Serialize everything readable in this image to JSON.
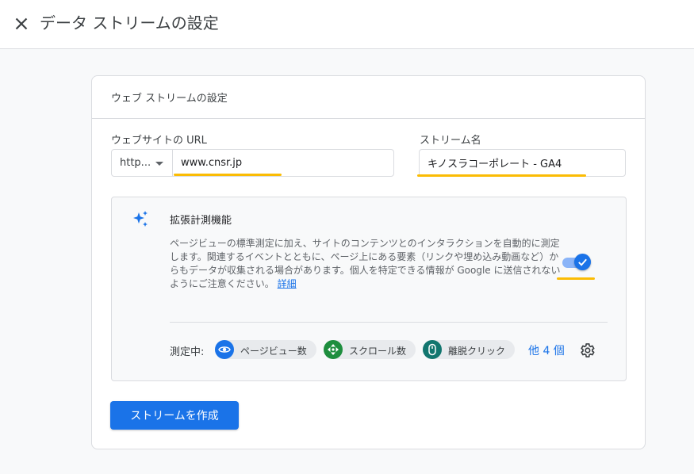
{
  "header": {
    "title": "データ ストリームの設定"
  },
  "card": {
    "header_title": "ウェブ ストリームの設定",
    "url_label": "ウェブサイトの URL",
    "protocol_value": "http...",
    "url_value": "www.cnsr.jp",
    "stream_name_label": "ストリーム名",
    "stream_name_value": "キノスラコーポレート - GA4"
  },
  "enhanced": {
    "title": "拡張計測機能",
    "description": "ページビューの標準測定に加え、サイトのコンテンツとのインタラクションを自動的に測定します。関連するイベントとともに、ページ上にある要素（リンクや埋め込み動画など）からもデータが収集される場合があります。個人を特定できる情報が Google に送信されないようにご注意ください。",
    "details_link": "詳細",
    "toggle_on": true,
    "measuring_label": "測定中:",
    "chips": [
      {
        "label": "ページビュー数",
        "icon": "eye-icon",
        "color": "#1a73e8"
      },
      {
        "label": "スクロール数",
        "icon": "scroll-arrows-icon",
        "color": "#1e8e3e"
      },
      {
        "label": "離脱クリック",
        "icon": "mouse-icon",
        "color": "#12766f"
      }
    ],
    "more_label": "他 4 個"
  },
  "actions": {
    "create_label": "ストリームを作成"
  },
  "colors": {
    "accent": "#1a73e8",
    "highlight": "#fbbc04"
  }
}
